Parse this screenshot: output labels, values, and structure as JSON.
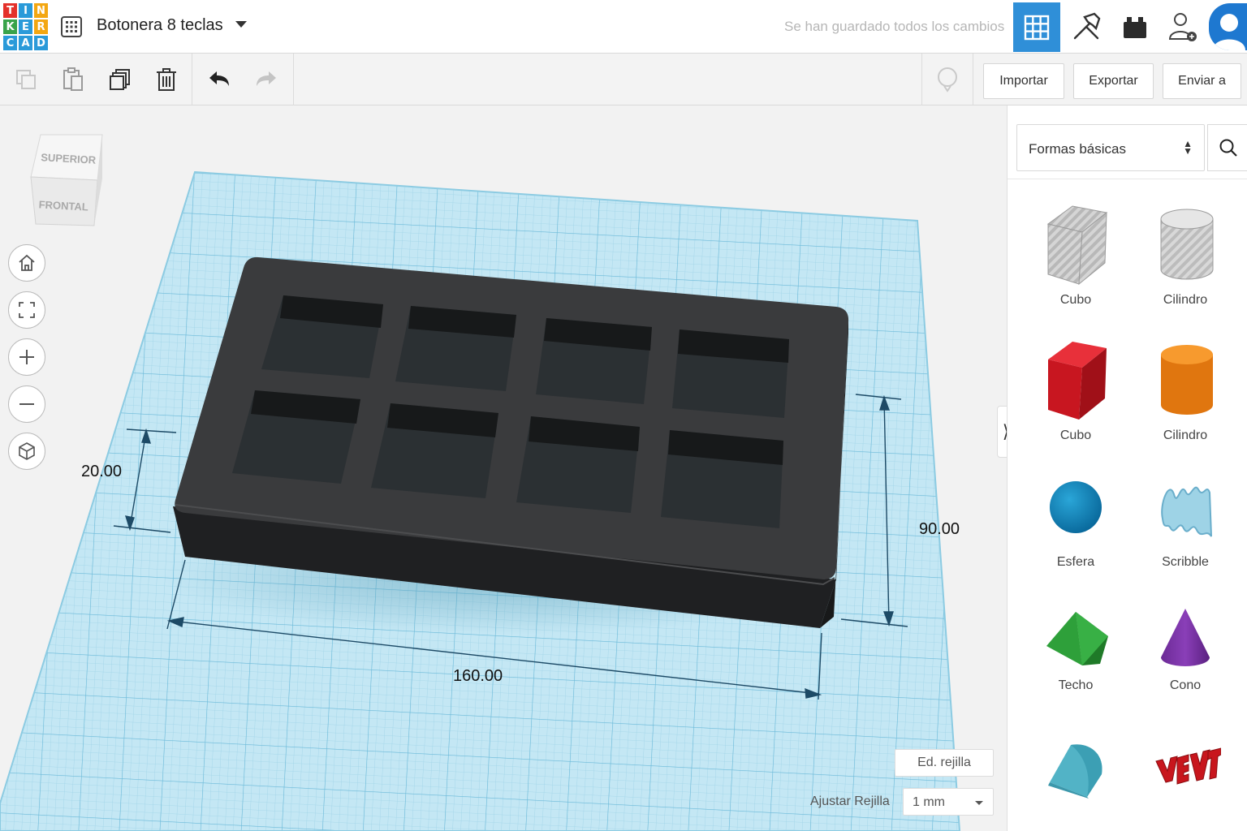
{
  "app": {
    "logo_letters": [
      "T",
      "I",
      "N",
      "K",
      "E",
      "R",
      "C",
      "A",
      "D"
    ],
    "logo_colors": [
      "#e4312b",
      "#2a9ad9",
      "#f3a712",
      "#39a34a",
      "#2a9ad9",
      "#f3a712",
      "#2a9ad9",
      "#2a9ad9",
      "#2a9ad9"
    ]
  },
  "header": {
    "design_title": "Botonera 8 teclas",
    "save_status": "Se han guardado todos los cambios",
    "accent_color": "#2f8fd8",
    "icons": [
      "grid-menu-icon",
      "3d-view-icon",
      "build-icon",
      "bricks-icon",
      "add-user-icon",
      "profile-icon"
    ]
  },
  "toolbar": {
    "tools": [
      "copy-icon",
      "paste-icon",
      "duplicate-icon",
      "delete-icon",
      "undo-icon",
      "redo-icon",
      "notes-icon"
    ],
    "import_label": "Importar",
    "export_label": "Exportar",
    "send_label": "Enviar a"
  },
  "viewport": {
    "view_cube": {
      "top_label": "SUPERIOR",
      "front_label": "FRONTAL"
    },
    "nav_buttons": [
      "home-icon",
      "fit-view-icon",
      "zoom-in-icon",
      "zoom-out-icon",
      "perspective-icon"
    ],
    "dimensions": {
      "height": "20.00",
      "length": "160.00",
      "width": "90.00"
    },
    "object_color": "#2c2e30",
    "grid_color": "#bfe5f3",
    "edit_grid_label": "Ed. rejilla",
    "snap_grid_label": "Ajustar Rejilla",
    "snap_grid_value": "1 mm",
    "panel_toggle_glyph": "⟩"
  },
  "shapes_panel": {
    "category": "Formas básicas",
    "shapes": [
      {
        "name": "Cubo",
        "icon": "cube-hole-icon"
      },
      {
        "name": "Cilindro",
        "icon": "cylinder-hole-icon"
      },
      {
        "name": "Cubo",
        "icon": "cube-icon"
      },
      {
        "name": "Cilindro",
        "icon": "cylinder-icon"
      },
      {
        "name": "Esfera",
        "icon": "sphere-icon"
      },
      {
        "name": "Scribble",
        "icon": "scribble-icon"
      },
      {
        "name": "Techo",
        "icon": "roof-icon"
      },
      {
        "name": "Cono",
        "icon": "cone-icon"
      },
      {
        "name": "",
        "icon": "round-roof-icon"
      },
      {
        "name": "",
        "icon": "text-icon"
      }
    ]
  }
}
